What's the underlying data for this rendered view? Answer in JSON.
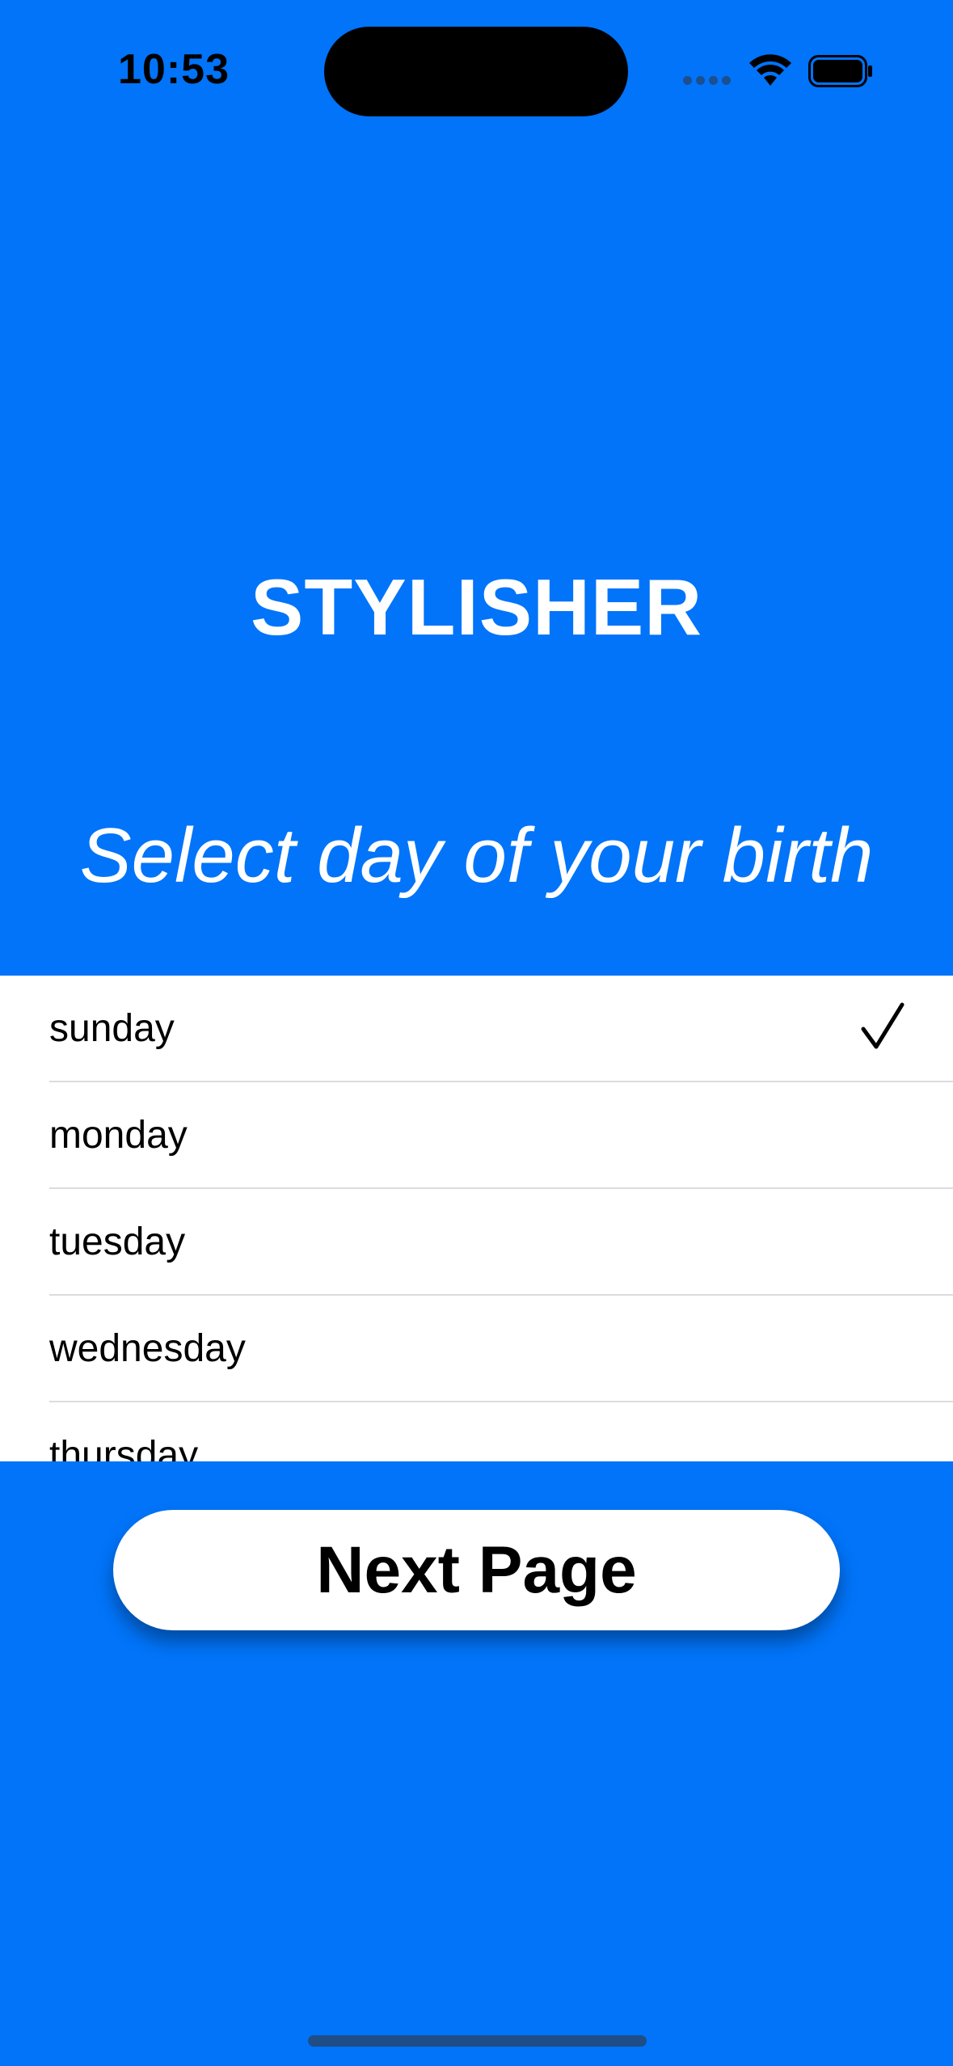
{
  "status_bar": {
    "time": "10:53"
  },
  "header": {
    "app_title": "STYLISHER",
    "subtitle": "Select day of your birth"
  },
  "day_list": {
    "items": [
      {
        "label": "sunday",
        "selected": true
      },
      {
        "label": "monday",
        "selected": false
      },
      {
        "label": "tuesday",
        "selected": false
      },
      {
        "label": "wednesday",
        "selected": false
      },
      {
        "label": "thursday",
        "selected": false
      }
    ]
  },
  "actions": {
    "next_label": "Next Page"
  },
  "colors": {
    "background": "#0174F9",
    "list_background": "#FFFFFF",
    "button_background": "#FFFFFF"
  },
  "icons": {
    "checkmark": "checkmark-icon",
    "wifi": "wifi-icon",
    "battery": "battery-icon",
    "signal": "signal-icon"
  }
}
